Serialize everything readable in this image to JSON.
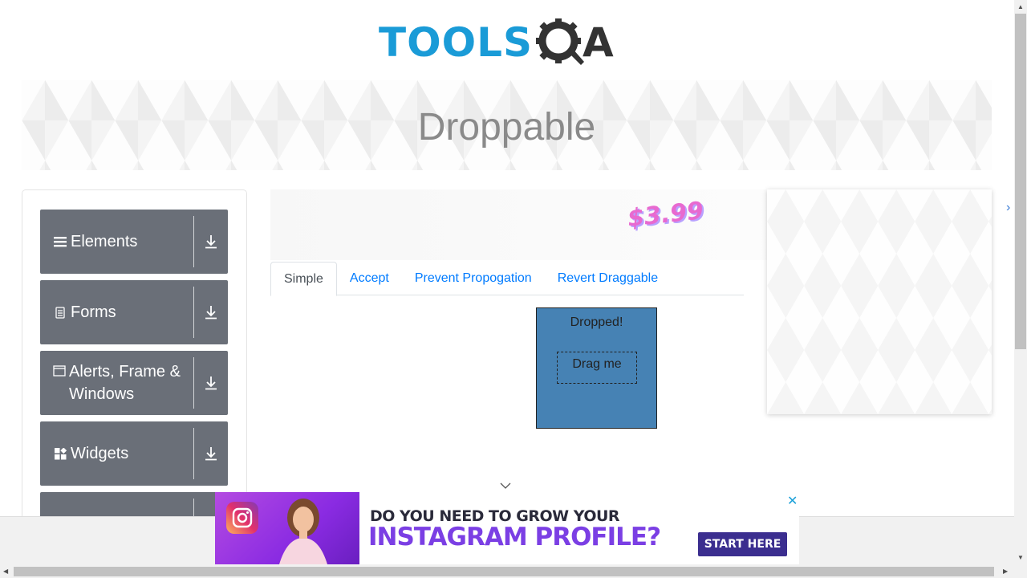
{
  "logo": {
    "text": "TOOLS",
    "suffix": "A"
  },
  "page_title": "Droppable",
  "sidebar": {
    "groups": [
      {
        "label": "Elements",
        "icon": "hamburger-icon"
      },
      {
        "label": "Forms",
        "icon": "document-icon"
      },
      {
        "label": "Alerts, Frame & Windows",
        "icon": "window-icon"
      },
      {
        "label": "Widgets",
        "icon": "widgets-icon"
      }
    ]
  },
  "mid_ad": {
    "price": "$3.99"
  },
  "tabs": [
    {
      "label": "Simple",
      "active": true
    },
    {
      "label": "Accept",
      "active": false
    },
    {
      "label": "Prevent Propogation",
      "active": false
    },
    {
      "label": "Revert Draggable",
      "active": false
    }
  ],
  "droppable": {
    "drop_text": "Dropped!",
    "drag_text": "Drag me"
  },
  "bottom_ad": {
    "line1": "DO YOU NEED TO GROW YOUR",
    "line2": "INSTAGRAM PROFILE?",
    "cta": "START HERE",
    "close": "✕"
  },
  "colors": {
    "brand_blue": "#1a9bd7",
    "sidebar_group": "#6a6f78",
    "drop_box": "#4682b4",
    "link": "#007bff"
  }
}
